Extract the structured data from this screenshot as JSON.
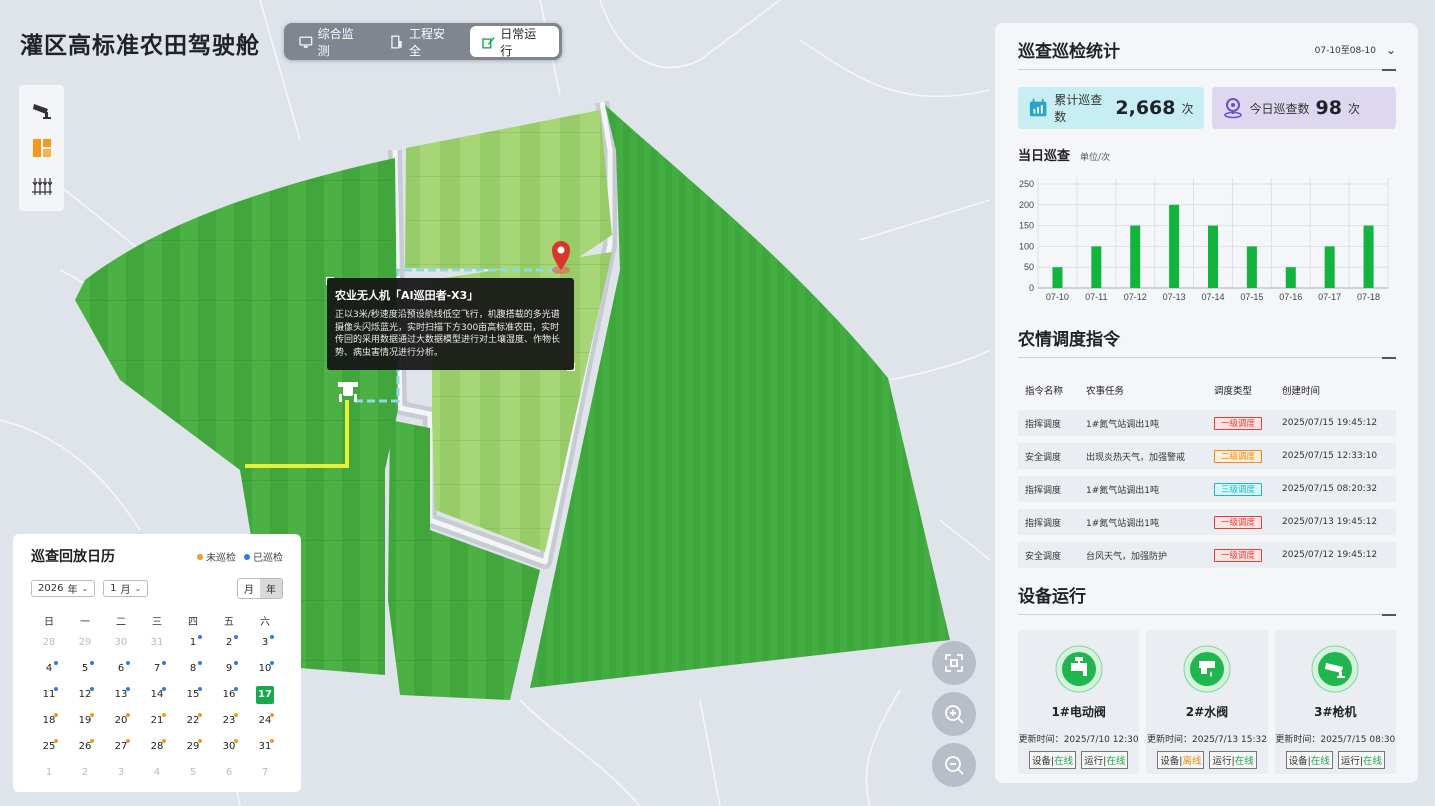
{
  "app": {
    "title": "灌区高标准农田驾驶舱"
  },
  "tabs": [
    {
      "label": "综合监测",
      "icon": "monitor-icon",
      "active": false
    },
    {
      "label": "工程安全",
      "icon": "building-icon",
      "active": false
    },
    {
      "label": "日常运行",
      "icon": "pencil-icon",
      "active": true
    }
  ],
  "toolbar": [
    "camera-icon",
    "field-layer-icon",
    "crop-icon"
  ],
  "popup": {
    "title": "农业无人机「AI巡田者-X3」",
    "body": "正以3米/秒速度沿预设航线低空飞行，机腹搭载的多光谱摄像头闪烁蓝光，实时扫描下方300亩高标准农田，实时传回的采用数据通过大数据模型进行对土壤湿度、作物长势、病虫害情况进行分析。"
  },
  "calendar": {
    "title": "巡查回放日历",
    "legend_unchecked": "未巡检",
    "legend_checked": "已巡检",
    "year": "2026",
    "year_unit": "年",
    "month": "1",
    "month_unit": "月",
    "mode_month": "月",
    "mode_year": "年",
    "weekdays": [
      "日",
      "一",
      "二",
      "三",
      "四",
      "五",
      "六"
    ],
    "days": [
      {
        "d": "28",
        "m": true,
        "k": ""
      },
      {
        "d": "29",
        "m": true,
        "k": ""
      },
      {
        "d": "30",
        "m": true,
        "k": ""
      },
      {
        "d": "31",
        "m": true,
        "k": ""
      },
      {
        "d": "1",
        "m": false,
        "k": "b"
      },
      {
        "d": "2",
        "m": false,
        "k": "b"
      },
      {
        "d": "3",
        "m": false,
        "k": "b"
      },
      {
        "d": "4",
        "m": false,
        "k": "b"
      },
      {
        "d": "5",
        "m": false,
        "k": "b"
      },
      {
        "d": "6",
        "m": false,
        "k": "b"
      },
      {
        "d": "7",
        "m": false,
        "k": "b"
      },
      {
        "d": "8",
        "m": false,
        "k": "b"
      },
      {
        "d": "9",
        "m": false,
        "k": "b"
      },
      {
        "d": "10",
        "m": false,
        "k": "b"
      },
      {
        "d": "11",
        "m": false,
        "k": "b"
      },
      {
        "d": "12",
        "m": false,
        "k": "b"
      },
      {
        "d": "13",
        "m": false,
        "k": "b"
      },
      {
        "d": "14",
        "m": false,
        "k": "b"
      },
      {
        "d": "15",
        "m": false,
        "k": "b"
      },
      {
        "d": "16",
        "m": false,
        "k": "b"
      },
      {
        "d": "17",
        "m": false,
        "k": "",
        "today": true
      },
      {
        "d": "18",
        "m": false,
        "k": "o"
      },
      {
        "d": "19",
        "m": false,
        "k": "o"
      },
      {
        "d": "20",
        "m": false,
        "k": "o"
      },
      {
        "d": "21",
        "m": false,
        "k": "o"
      },
      {
        "d": "22",
        "m": false,
        "k": "o"
      },
      {
        "d": "23",
        "m": false,
        "k": "o"
      },
      {
        "d": "24",
        "m": false,
        "k": "o"
      },
      {
        "d": "25",
        "m": false,
        "k": "o"
      },
      {
        "d": "26",
        "m": false,
        "k": "o"
      },
      {
        "d": "27",
        "m": false,
        "k": "o"
      },
      {
        "d": "28",
        "m": false,
        "k": "o"
      },
      {
        "d": "29",
        "m": false,
        "k": "o"
      },
      {
        "d": "30",
        "m": false,
        "k": "o"
      },
      {
        "d": "31",
        "m": false,
        "k": "o"
      },
      {
        "d": "1",
        "m": true,
        "k": ""
      },
      {
        "d": "2",
        "m": true,
        "k": ""
      },
      {
        "d": "3",
        "m": true,
        "k": ""
      },
      {
        "d": "4",
        "m": true,
        "k": ""
      },
      {
        "d": "5",
        "m": true,
        "k": ""
      },
      {
        "d": "6",
        "m": true,
        "k": ""
      },
      {
        "d": "7",
        "m": true,
        "k": ""
      }
    ]
  },
  "patrol": {
    "title": "巡查巡检统计",
    "date_range": "07-10至08-10",
    "total_label": "累计巡查数",
    "total_value": "2,668",
    "total_unit": "次",
    "today_label": "今日巡查数",
    "today_value": "98",
    "today_unit": "次",
    "chart_title": "当日巡查",
    "chart_unit": "单位/次"
  },
  "chart_data": {
    "type": "bar",
    "categories": [
      "07-10",
      "07-11",
      "07-12",
      "07-13",
      "07-14",
      "07-15",
      "07-16",
      "07-17",
      "07-18"
    ],
    "values": [
      50,
      100,
      150,
      200,
      150,
      100,
      50,
      100,
      150
    ],
    "yticks": [
      0,
      50,
      100,
      150,
      200,
      250
    ],
    "ylim": [
      0,
      250
    ],
    "grid": true,
    "color": "#12b43e"
  },
  "orders": {
    "title": "农情调度指令",
    "headers": [
      "指令名称",
      "农事任务",
      "调度类型",
      "创建时间"
    ],
    "rows": [
      {
        "name": "指挥调度",
        "task": "1#氮气站调出1吨",
        "type": "一级调度",
        "level": "red",
        "time": "2025/07/15 19:45:12"
      },
      {
        "name": "安全调度",
        "task": "出现炎热天气，加强警戒",
        "type": "二级调度",
        "level": "orange",
        "time": "2025/07/15 12:33:10"
      },
      {
        "name": "指挥调度",
        "task": "1#氮气站调出1吨",
        "type": "三级调度",
        "level": "cyan",
        "time": "2025/07/15 08:20:32"
      },
      {
        "name": "指挥调度",
        "task": "1#氮气站调出1吨",
        "type": "一级调度",
        "level": "red",
        "time": "2025/07/13 19:45:12"
      },
      {
        "name": "安全调度",
        "task": "台风天气，加强防护",
        "type": "一级调度",
        "level": "red",
        "time": "2025/07/12 19:45:12"
      }
    ]
  },
  "devices": {
    "title": "设备运行",
    "time_label": "更新时间：",
    "device_label": "设备|",
    "run_label": "运行|",
    "items": [
      {
        "name": "1#电动阀",
        "icon": "valve-icon",
        "time": "2025/7/10 12:30",
        "device_status": "在线",
        "device_ok": true,
        "run_status": "在线",
        "run_ok": true
      },
      {
        "name": "2#水阀",
        "icon": "water-valve-icon",
        "time": "2025/7/13 15:32",
        "device_status": "离线",
        "device_ok": false,
        "run_status": "在线",
        "run_ok": true
      },
      {
        "name": "3#枪机",
        "icon": "camera-icon",
        "time": "2025/7/15 08:30",
        "device_status": "在线",
        "device_ok": true,
        "run_status": "在线",
        "run_ok": true
      }
    ]
  },
  "colors": {
    "accent": "#1aa84a",
    "checked_dot": "#2f7de1",
    "unchecked_dot": "#f29a1e",
    "field_dark": "#3aa13a",
    "field_light": "#9bd06a"
  }
}
